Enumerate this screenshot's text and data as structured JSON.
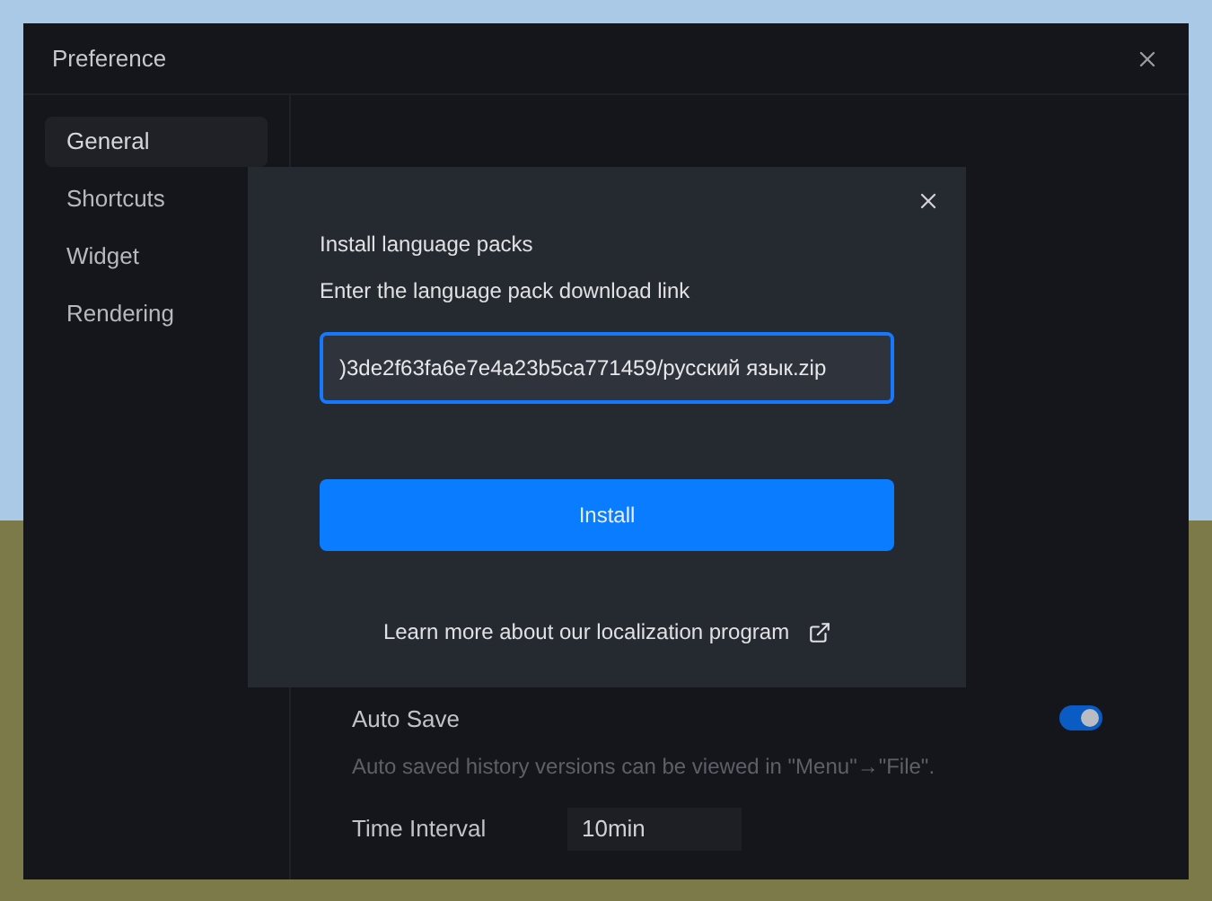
{
  "window": {
    "title": "Preference"
  },
  "sidebar": {
    "items": [
      {
        "label": "General",
        "selected": true
      },
      {
        "label": "Shortcuts",
        "selected": false
      },
      {
        "label": "Widget",
        "selected": false
      },
      {
        "label": "Rendering",
        "selected": false
      }
    ]
  },
  "settings": {
    "auto_save": {
      "label": "Auto Save",
      "on": true,
      "description": "Auto saved history versions can be viewed in \"Menu\"→\"File\"."
    },
    "time_interval": {
      "label": "Time Interval",
      "value": "10min"
    }
  },
  "dialog": {
    "title": "Install language packs",
    "prompt": "Enter the language pack download link",
    "link_value": ")3de2f63fa6e7e4a23b5ca771459/русский язык.zip",
    "button": "Install",
    "learn_more": "Learn more about our localization program"
  }
}
